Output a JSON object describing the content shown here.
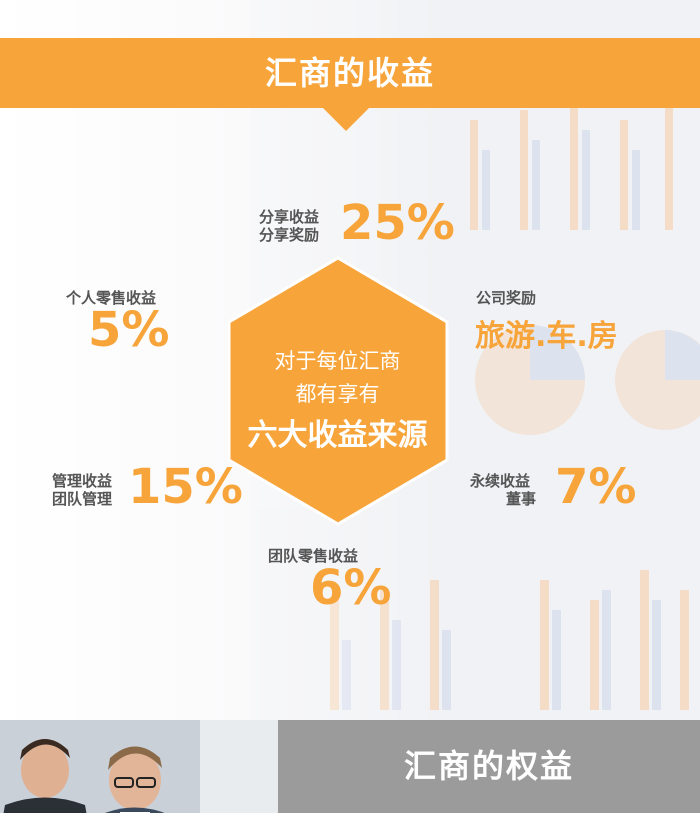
{
  "header": {
    "title": "汇商的收益"
  },
  "center": {
    "line1": "对于每位汇商",
    "line2": "都有享有",
    "line3": "六大收益来源"
  },
  "items": [
    {
      "id": "share",
      "line1": "分享收益",
      "line2": "分享奖励",
      "value": "25%"
    },
    {
      "id": "personal",
      "line1": "个人零售收益",
      "value": "5%"
    },
    {
      "id": "company",
      "line1": "公司奖励",
      "value": "旅游.车.房"
    },
    {
      "id": "management",
      "line1": "管理收益",
      "line2": "团队管理",
      "value": "15%"
    },
    {
      "id": "perpetual",
      "line1": "永续收益",
      "line2": "董事",
      "value": "7%"
    },
    {
      "id": "team",
      "line1": "团队零售收益",
      "value": "6%"
    }
  ],
  "footer": {
    "title": "汇商的权益"
  },
  "colors": {
    "accent": "#f7a43a",
    "gray": "#9b9b9b",
    "label": "#555555"
  }
}
